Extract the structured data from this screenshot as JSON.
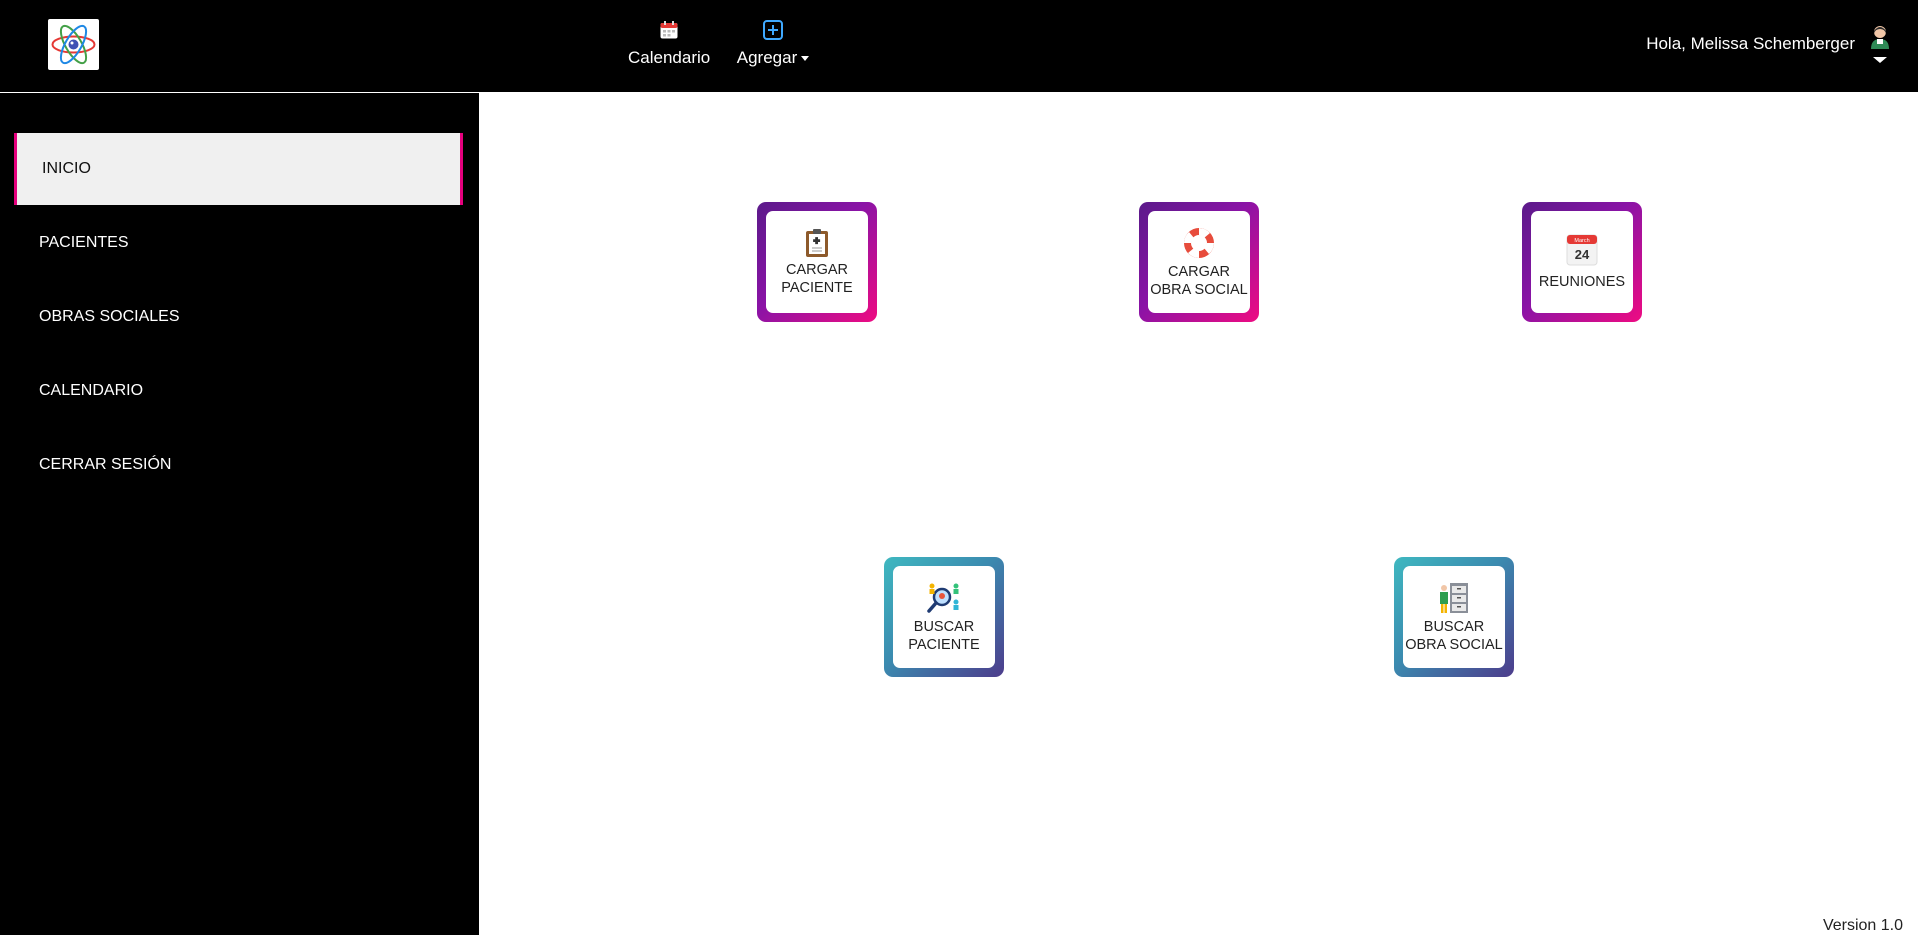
{
  "topbar": {
    "calendar_label": "Calendario",
    "add_label": "Agregar",
    "greeting": "Hola, Melissa Schemberger"
  },
  "sidebar": {
    "items": [
      {
        "label": "INICIO",
        "active": true
      },
      {
        "label": "PACIENTES"
      },
      {
        "label": "OBRAS SOCIALES"
      },
      {
        "label": "CALENDARIO"
      },
      {
        "label": "CERRAR SESIÓN"
      }
    ]
  },
  "tiles": [
    {
      "line1": "CARGAR",
      "line2": "PACIENTE",
      "icon": "clipboard-icon"
    },
    {
      "line1": "CARGAR",
      "line2": "OBRA SOCIAL",
      "icon": "lifebuoy-icon"
    },
    {
      "line1": "REUNIONES",
      "icon": "calendar-date-icon",
      "cal_month": "March",
      "cal_day": "24"
    },
    {
      "line1": "BUSCAR",
      "line2": "PACIENTE",
      "icon": "magnifier-people-icon"
    },
    {
      "line1": "BUSCAR",
      "line2": "OBRA SOCIAL",
      "icon": "archive-shelf-icon"
    }
  ],
  "footer": {
    "version": "Version 1.0"
  },
  "colors": {
    "accent_pink": "#e6007e",
    "tile_gradient_purple": [
      "#5b1a8a",
      "#ee0b82"
    ],
    "tile_gradient_teal": [
      "#3fb8c0",
      "#4d3c8c"
    ]
  }
}
